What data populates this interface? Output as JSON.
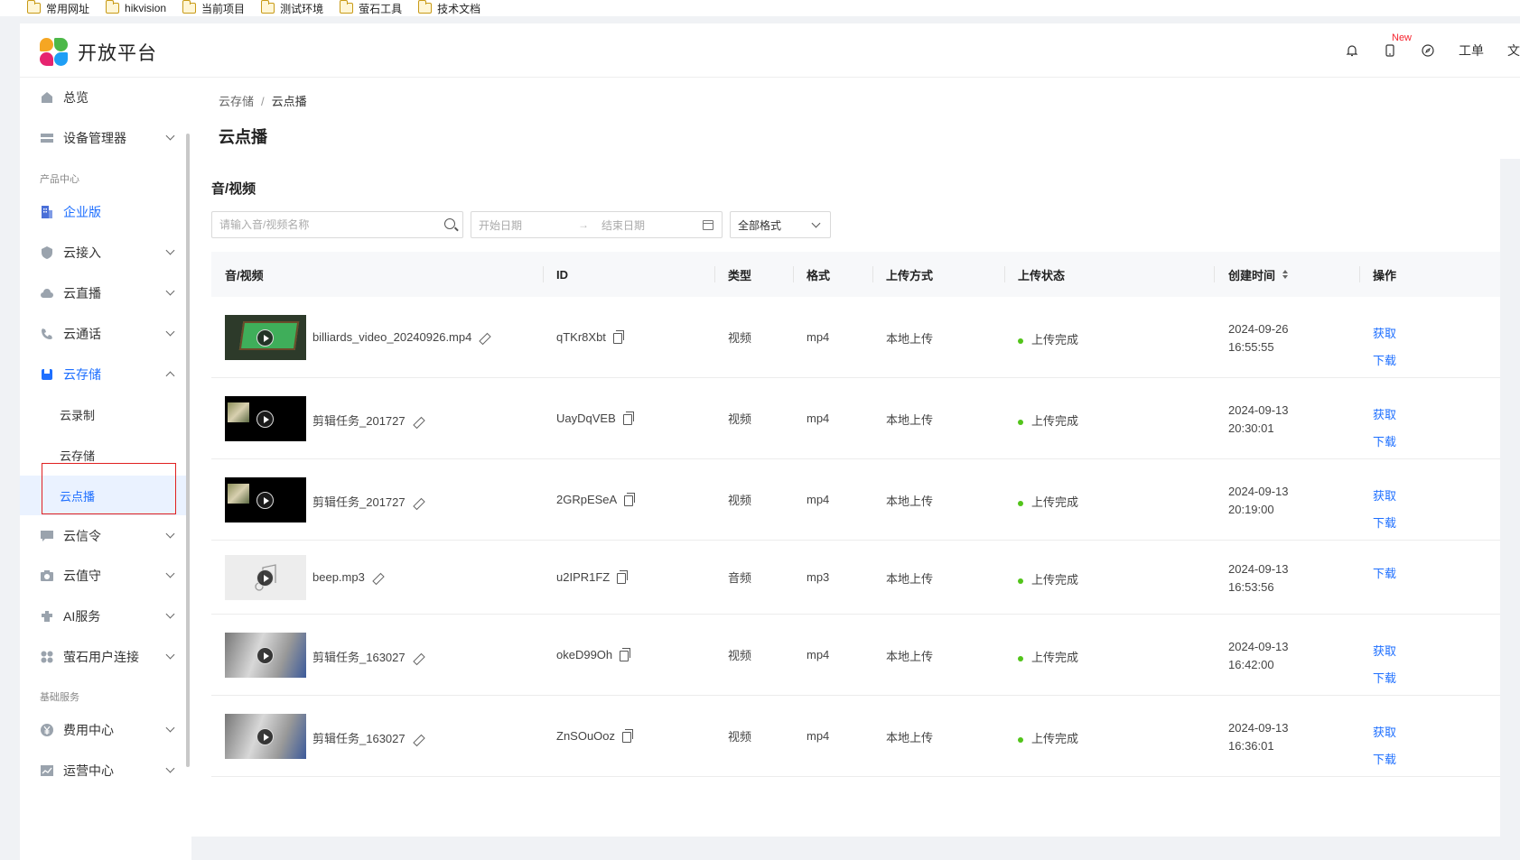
{
  "bookmarks": [
    "常用网址",
    "hikvision",
    "当前项目",
    "测试环境",
    "萤石工具",
    "技术文档"
  ],
  "header": {
    "title": "开放平台",
    "new_badge": "New",
    "ticket_label": "工单",
    "doc_label": "文"
  },
  "sidebar": {
    "overview": "总览",
    "device_manager": "设备管理器",
    "group_product": "产品中心",
    "enterprise": "企业版",
    "cloud_access": "云接入",
    "cloud_live": "云直播",
    "cloud_call": "云通话",
    "cloud_storage": "云存储",
    "sub_record": "云录制",
    "sub_storage": "云存储",
    "sub_vod": "云点播",
    "cloud_signal": "云信令",
    "cloud_guard": "云值守",
    "ai_service": "AI服务",
    "ys_user": "萤石用户连接",
    "group_basic": "基础服务",
    "billing": "费用中心",
    "operation": "运营中心"
  },
  "breadcrumb": {
    "parent": "云存储",
    "sep": "/",
    "current": "云点播"
  },
  "page_title": "云点播",
  "card_title": "音/视频",
  "filters": {
    "search_placeholder": "请输入音/视频名称",
    "start_date": "开始日期",
    "arrow": "→",
    "end_date": "结束日期",
    "format_selected": "全部格式"
  },
  "table": {
    "headers": {
      "media": "音/视频",
      "id": "ID",
      "type": "类型",
      "format": "格式",
      "upload_method": "上传方式",
      "upload_status": "上传状态",
      "created": "创建时间",
      "actions": "操作"
    },
    "rows": [
      {
        "name": "billiards_video_20240926.mp4",
        "id": "qTKr8Xbt",
        "type": "视频",
        "format": "mp4",
        "method": "本地上传",
        "status": "上传完成",
        "date": "2024-09-26",
        "time": "16:55:55",
        "action1": "获取",
        "action2": "下载",
        "thumb": "billiards"
      },
      {
        "name": "剪辑任务_201727",
        "id": "UayDqVEB",
        "type": "视频",
        "format": "mp4",
        "method": "本地上传",
        "status": "上传完成",
        "date": "2024-09-13",
        "time": "20:30:01",
        "action1": "获取",
        "action2": "下载",
        "thumb": "dark"
      },
      {
        "name": "剪辑任务_201727",
        "id": "2GRpESeA",
        "type": "视频",
        "format": "mp4",
        "method": "本地上传",
        "status": "上传完成",
        "date": "2024-09-13",
        "time": "20:19:00",
        "action1": "获取",
        "action2": "下载",
        "thumb": "dark"
      },
      {
        "name": "beep.mp3",
        "id": "u2IPR1FZ",
        "type": "音频",
        "format": "mp3",
        "method": "本地上传",
        "status": "上传完成",
        "date": "2024-09-13",
        "time": "16:53:56",
        "action1": "下载",
        "action2": "",
        "thumb": "audio"
      },
      {
        "name": "剪辑任务_163027",
        "id": "okeD99Oh",
        "type": "视频",
        "format": "mp4",
        "method": "本地上传",
        "status": "上传完成",
        "date": "2024-09-13",
        "time": "16:42:00",
        "action1": "获取",
        "action2": "下载",
        "thumb": "gray"
      },
      {
        "name": "剪辑任务_163027",
        "id": "ZnSOuOoz",
        "type": "视频",
        "format": "mp4",
        "method": "本地上传",
        "status": "上传完成",
        "date": "2024-09-13",
        "time": "16:36:01",
        "action1": "获取",
        "action2": "下载",
        "thumb": "gray"
      }
    ]
  },
  "colors": {
    "accent": "#1e6fff",
    "success": "#52c41a",
    "highlight_border": "#e02020"
  }
}
